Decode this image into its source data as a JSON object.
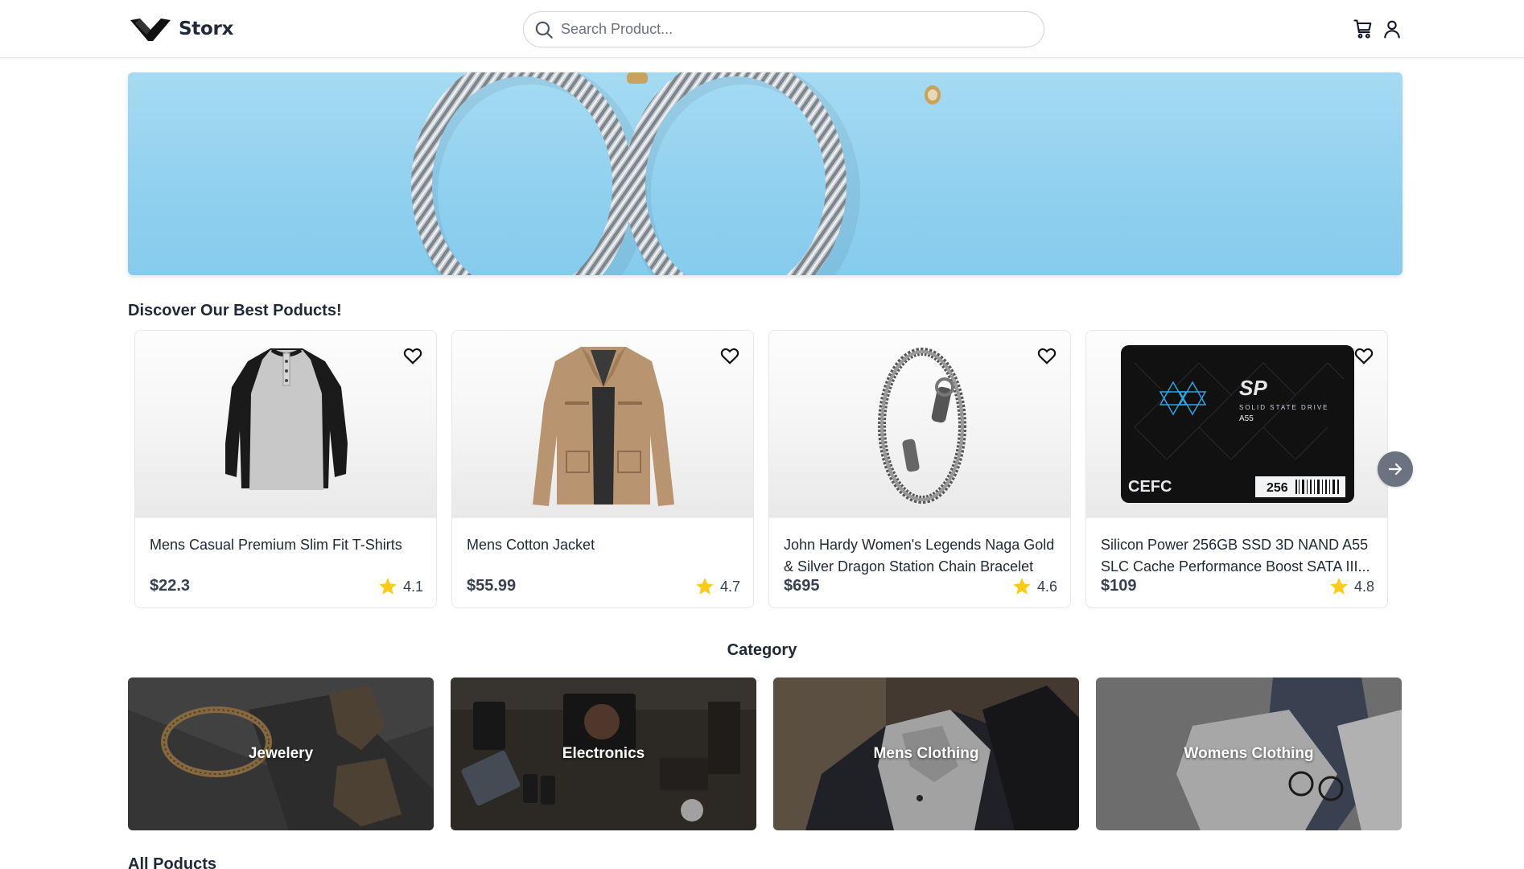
{
  "header": {
    "brand": "Storx",
    "search_placeholder": "Search Product...",
    "icons": [
      "cart-icon",
      "user-icon"
    ]
  },
  "banner": {
    "image": "silver twisted cable bracelets on light blue background",
    "colors": {
      "background": "#9ad4ef"
    }
  },
  "best_products": {
    "title": "Discover Our Best Poducts!",
    "items": [
      {
        "title": "Mens Casual Premium Slim Fit T-Shirts",
        "price": "$22.3",
        "rating": "4.1",
        "image": "raglan henley t-shirt"
      },
      {
        "title": "Mens Cotton Jacket",
        "price": "$55.99",
        "rating": "4.7",
        "image": "tan cotton jacket"
      },
      {
        "title": "John Hardy Women's Legends Naga Gold & Silver Dragon Station Chain Bracelet",
        "price": "$695",
        "rating": "4.6",
        "image": "silver dragon chain bracelet"
      },
      {
        "title": "Silicon Power 256GB SSD 3D NAND A55 SLC Cache Performance Boost SATA III...",
        "price": "$109",
        "rating": "4.8",
        "image": "SP A55 solid state drive",
        "ssd_capacity": "256",
        "ssd_brand": "SP",
        "ssd_model": "A55"
      }
    ],
    "next_button_icon": "arrow-right-icon"
  },
  "category": {
    "title": "Category",
    "items": [
      {
        "label": "Jewelery"
      },
      {
        "label": "Electronics"
      },
      {
        "label": "Mens Clothing"
      },
      {
        "label": "Womens Clothing"
      }
    ]
  },
  "all_products": {
    "title": "All Poducts"
  },
  "colors": {
    "star": "#facc15",
    "text": "#1f2937",
    "border": "#e5e7eb"
  }
}
